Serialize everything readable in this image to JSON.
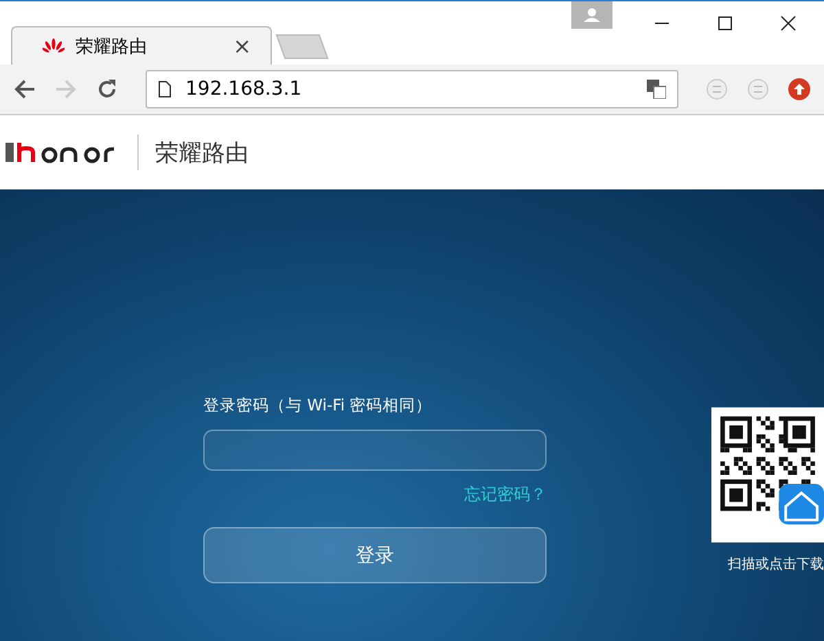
{
  "browser": {
    "tabs": [
      {
        "title": "荣耀路由",
        "selected": true,
        "close": "×"
      }
    ],
    "address": "192.168.3.1"
  },
  "header": {
    "brand": "荣耀路由"
  },
  "login": {
    "label": "登录密码（与 Wi-Fi 密码相同）",
    "forgot": "忘记密码？",
    "submit": "登录"
  },
  "app_download": {
    "caption": "扫描或点击下载"
  }
}
